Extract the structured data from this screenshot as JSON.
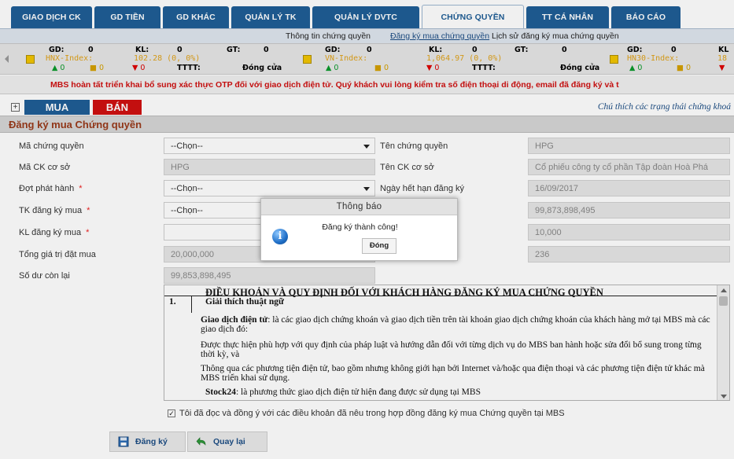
{
  "tabs": [
    {
      "label": "GIAO DỊCH CK",
      "active": false
    },
    {
      "label": "GD TIỀN",
      "active": false
    },
    {
      "label": "GD KHÁC",
      "active": false
    },
    {
      "label": "QUẢN LÝ TK",
      "active": false
    },
    {
      "label": "QUẢN LÝ DVTC",
      "active": false
    },
    {
      "label": "CHỨNG QUYỀN",
      "active": true
    },
    {
      "label": "TT CÁ NHÂN",
      "active": false
    },
    {
      "label": "BÁO CÁO",
      "active": false
    }
  ],
  "subnav": {
    "info": "Thông tin chứng quyền",
    "register": "Đăng ký mua chứng quyền",
    "history": "Lịch sử đăng ký mua chứng quyền"
  },
  "ticker": [
    {
      "gd_label": "GD:",
      "gd": "0",
      "kl_label": "KL:",
      "kl": "0",
      "gt_label": "GT:",
      "gt": "0",
      "index": "HNX-Index:",
      "value": "102.28 (0, 0%)",
      "up": "▲ 0",
      "ref": "■ 0",
      "down": "▼ 0",
      "tttt": "TTTT:",
      "status": "Đóng cửa"
    },
    {
      "gd_label": "GD:",
      "gd": "0",
      "kl_label": "KL:",
      "kl": "0",
      "gt_label": "GT:",
      "gt": "0",
      "index": "VN-Index:",
      "value": "1,064.97 (0, 0%)",
      "up": "▲ 0",
      "ref": "■ 0",
      "down": "▼ 0",
      "tttt": "TTTT:",
      "status": "Đóng cửa"
    },
    {
      "gd_label": "GD:",
      "gd": "0",
      "kl_label": "KL",
      "index": "HN30-Index:",
      "value": "18",
      "up": "▲ 0",
      "ref": "■ 0",
      "down": "▼"
    }
  ],
  "banner": "MBS hoàn tất triển khai bổ sung xác thực OTP đối với giao dịch điện tử. Quý khách vui lòng kiểm tra số điện thoại di động, email đã đăng ký và t",
  "actions": {
    "buy": "MUA",
    "sell": "BÁN",
    "legend": "Chú thích các trạng thái chứng khoá"
  },
  "section_title": "Đăng ký mua Chứng quyền",
  "form": {
    "ma_cq_label": "Mã chứng quyền",
    "ma_cq_value": "--Chọn--",
    "ten_cq_label": "Tên chứng quyền",
    "ten_cq_value": "HPG",
    "ma_ck_label": "Mã CK cơ sở",
    "ma_ck_value": "HPG",
    "ten_ck_label": "Tên CK cơ sở",
    "ten_ck_value": "Cổ phiếu công ty cổ phần Tập đoàn Hoà Phá",
    "dot_label": "Đợt phát hành",
    "dot_value": "--Chọn--",
    "han_label": "Ngày hết hạn đăng ký",
    "han_value": "16/09/2017",
    "tk_label": "TK đăng ký mua",
    "tk_value": "--Chọn--",
    "right4_value": "99,873,898,495",
    "kl_label": "KL đăng ký mua",
    "right5_value": "10,000",
    "tong_label": "Tổng giá trị đặt mua",
    "tong_value": "20,000,000",
    "right6_value": "236",
    "sodu_label": "Số dư còn lại",
    "sodu_value": "99,853,898,495",
    "required_mark": "*"
  },
  "terms": {
    "title": "ĐIỀU KHOẢN VÀ QUY ĐỊNH ĐỐI VỚI KHÁCH HÀNG ĐĂNG KÝ MUA CHỨNG QUYỀN",
    "num": "1.",
    "heading": "Giải thích thuật ngữ",
    "p1_term": "Giao dịch điện tử",
    "p1_text": ": là các giao dịch chứng  khoán và giao dịch tiền trên tài khoản giao dịch chứng khoán của khách hàng mở tại MBS mà các giao dịch đó:",
    "p2": "Được thực hiện phù hợp với quy định của pháp luật và hướng dẫn đối với từng dịch vụ do MBS ban hành hoặc sửa đổi bổ sung trong từng thời kỳ, và",
    "p3": "Thông qua các phương tiện điện tử, bao gồm nhưng không giới hạn bởi Internet và/hoặc qua điện thoại và các phương tiện điện tử khác mà MBS triển khai sử dụng.",
    "p4_term": "Stock24",
    "p4_text": ": là phương thức giao dịch điện tử  hiện đang được sử dụng tại MBS"
  },
  "agree_text": "Tôi đã đọc và đồng ý với các điều khoản đã nêu trong hợp đồng đăng ký mua Chứng quyền tại MBS",
  "buttons": {
    "register": "Đăng ký",
    "back": "Quay lại"
  },
  "modal": {
    "title": "Thông báo",
    "message": "Đăng ký thành công!",
    "close": "Đóng"
  },
  "colors": {
    "tab_blue": "#1f5e96",
    "sell_red": "#d01010",
    "section_title": "#9a3a1a",
    "index_yellow": "#e0a21a"
  }
}
